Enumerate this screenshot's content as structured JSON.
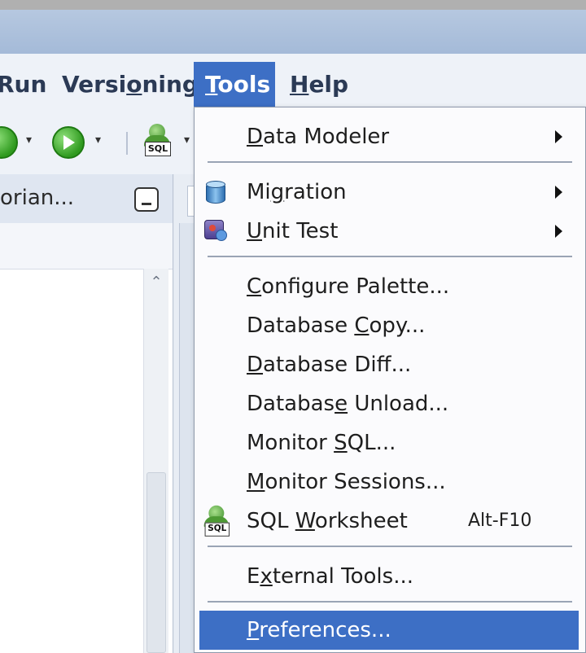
{
  "menu": {
    "run": {
      "pre": "",
      "u": "",
      "post": "Run"
    },
    "versioning": {
      "pre": "Versi",
      "u": "o",
      "post": "ning"
    },
    "tools": {
      "pre": "",
      "u": "T",
      "post": "ools"
    },
    "help": {
      "pre": "",
      "u": "H",
      "post": "elp"
    }
  },
  "toolbar": {
    "sql_tag": "SQL"
  },
  "left_panel": {
    "title": "orian..."
  },
  "tools_menu": {
    "items": [
      {
        "pre": "",
        "u": "D",
        "post": "ata Modeler"
      },
      {
        "pre": "Mi",
        "u": "g",
        "post": "ration"
      },
      {
        "pre": "",
        "u": "U",
        "post": "nit Test"
      },
      {
        "pre": "",
        "u": "C",
        "post": "onfigure Palette..."
      },
      {
        "pre": "Database ",
        "u": "C",
        "post": "opy..."
      },
      {
        "pre": "",
        "u": "D",
        "post": "atabase Diff..."
      },
      {
        "pre": "Databas",
        "u": "e",
        "post": " Unload..."
      },
      {
        "pre": "Monitor ",
        "u": "S",
        "post": "QL..."
      },
      {
        "pre": "",
        "u": "M",
        "post": "onitor Sessions..."
      },
      {
        "pre": "SQL ",
        "u": "W",
        "post": "orksheet",
        "shortcut": "Alt-F10"
      },
      {
        "pre": "E",
        "u": "x",
        "post": "ternal Tools..."
      },
      {
        "pre": "",
        "u": "P",
        "post": "references..."
      }
    ]
  },
  "colors": {
    "menu_highlight": "#3d6fc5",
    "title_bar": "#a4bad8"
  },
  "icons": {
    "migration": "database-icon",
    "unit_test": "unit-test-icon",
    "sql_worksheet": "sql-worksheet-icon",
    "run": "run-icon",
    "debug": "debug-icon"
  }
}
